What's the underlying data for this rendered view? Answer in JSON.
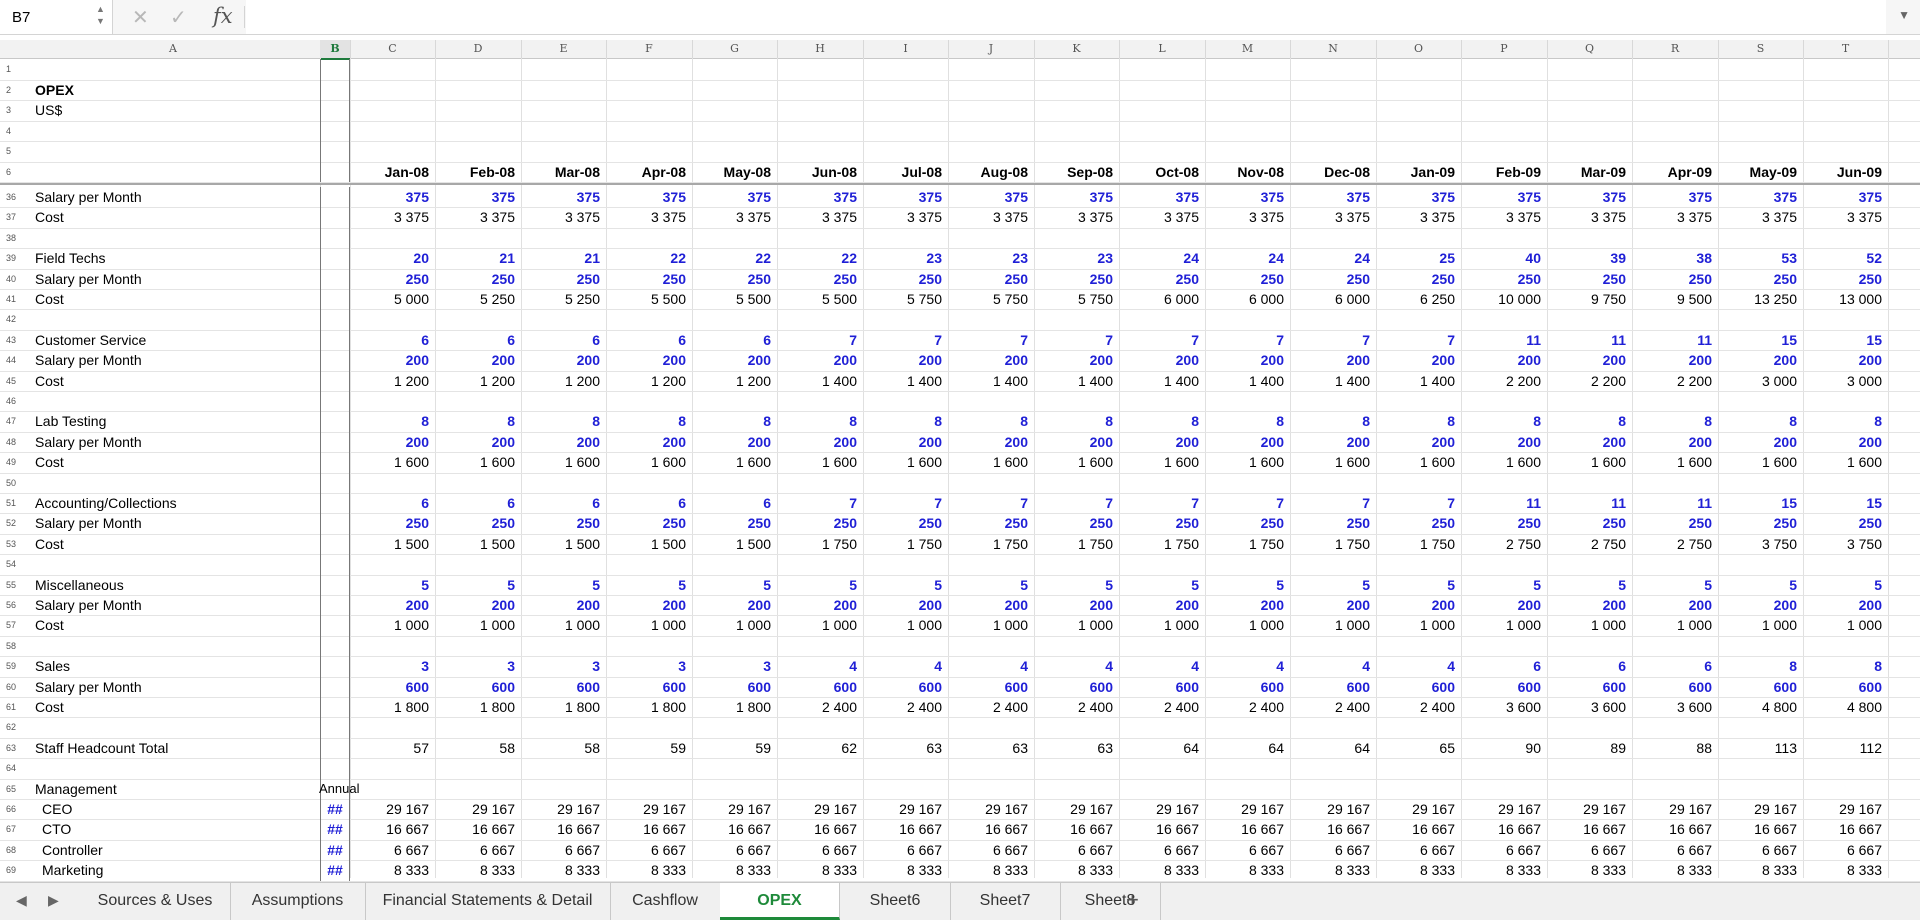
{
  "formula_bar": {
    "cell_ref": "B7",
    "fx": "fx",
    "formula": ""
  },
  "columns": [
    "A",
    "B",
    "C",
    "D",
    "E",
    "F",
    "G",
    "H",
    "I",
    "J",
    "K",
    "L",
    "M",
    "N",
    "O",
    "P",
    "Q",
    "R",
    "S",
    "T"
  ],
  "selected_column": "B",
  "header_rows": [
    {
      "num": "1",
      "a": "",
      "b": "",
      "bold": false,
      "values": []
    },
    {
      "num": "2",
      "a": "OPEX",
      "b": "",
      "bold": true,
      "values": []
    },
    {
      "num": "3",
      "a": "US$",
      "b": "",
      "bold": false,
      "values": []
    },
    {
      "num": "4",
      "a": "",
      "b": "",
      "bold": false,
      "values": []
    },
    {
      "num": "5",
      "a": "",
      "b": "",
      "bold": false,
      "values": []
    },
    {
      "num": "6",
      "a": "",
      "b": "",
      "bold": true,
      "values": [
        "Jan-08",
        "Feb-08",
        "Mar-08",
        "Apr-08",
        "May-08",
        "Jun-08",
        "Jul-08",
        "Aug-08",
        "Sep-08",
        "Oct-08",
        "Nov-08",
        "Dec-08",
        "Jan-09",
        "Feb-09",
        "Mar-09",
        "Apr-09",
        "May-09",
        "Jun-09"
      ]
    }
  ],
  "body_rows": [
    {
      "num": "36",
      "a": "Salary per Month",
      "b": "",
      "style": "blue",
      "values": [
        "375",
        "375",
        "375",
        "375",
        "375",
        "375",
        "375",
        "375",
        "375",
        "375",
        "375",
        "375",
        "375",
        "375",
        "375",
        "375",
        "375",
        "375"
      ]
    },
    {
      "num": "37",
      "a": "Cost",
      "b": "",
      "style": "plain",
      "values": [
        "3 375",
        "3 375",
        "3 375",
        "3 375",
        "3 375",
        "3 375",
        "3 375",
        "3 375",
        "3 375",
        "3 375",
        "3 375",
        "3 375",
        "3 375",
        "3 375",
        "3 375",
        "3 375",
        "3 375",
        "3 375"
      ]
    },
    {
      "num": "38",
      "a": "",
      "b": "",
      "style": "plain",
      "values": []
    },
    {
      "num": "39",
      "a": "Field Techs",
      "b": "",
      "style": "blue",
      "values": [
        "20",
        "21",
        "21",
        "22",
        "22",
        "22",
        "23",
        "23",
        "23",
        "24",
        "24",
        "24",
        "25",
        "40",
        "39",
        "38",
        "53",
        "52"
      ]
    },
    {
      "num": "40",
      "a": "Salary per Month",
      "b": "",
      "style": "blue",
      "values": [
        "250",
        "250",
        "250",
        "250",
        "250",
        "250",
        "250",
        "250",
        "250",
        "250",
        "250",
        "250",
        "250",
        "250",
        "250",
        "250",
        "250",
        "250"
      ]
    },
    {
      "num": "41",
      "a": "Cost",
      "b": "",
      "style": "plain",
      "values": [
        "5 000",
        "5 250",
        "5 250",
        "5 500",
        "5 500",
        "5 500",
        "5 750",
        "5 750",
        "5 750",
        "6 000",
        "6 000",
        "6 000",
        "6 250",
        "10 000",
        "9 750",
        "9 500",
        "13 250",
        "13 000"
      ]
    },
    {
      "num": "42",
      "a": "",
      "b": "",
      "style": "plain",
      "values": []
    },
    {
      "num": "43",
      "a": "Customer Service",
      "b": "",
      "style": "blue",
      "values": [
        "6",
        "6",
        "6",
        "6",
        "6",
        "7",
        "7",
        "7",
        "7",
        "7",
        "7",
        "7",
        "7",
        "11",
        "11",
        "11",
        "15",
        "15"
      ]
    },
    {
      "num": "44",
      "a": "Salary per Month",
      "b": "",
      "style": "blue",
      "values": [
        "200",
        "200",
        "200",
        "200",
        "200",
        "200",
        "200",
        "200",
        "200",
        "200",
        "200",
        "200",
        "200",
        "200",
        "200",
        "200",
        "200",
        "200"
      ]
    },
    {
      "num": "45",
      "a": "Cost",
      "b": "",
      "style": "plain",
      "values": [
        "1 200",
        "1 200",
        "1 200",
        "1 200",
        "1 200",
        "1 400",
        "1 400",
        "1 400",
        "1 400",
        "1 400",
        "1 400",
        "1 400",
        "1 400",
        "2 200",
        "2 200",
        "2 200",
        "3 000",
        "3 000"
      ]
    },
    {
      "num": "46",
      "a": "",
      "b": "",
      "style": "plain",
      "values": []
    },
    {
      "num": "47",
      "a": "Lab Testing",
      "b": "",
      "style": "blue",
      "values": [
        "8",
        "8",
        "8",
        "8",
        "8",
        "8",
        "8",
        "8",
        "8",
        "8",
        "8",
        "8",
        "8",
        "8",
        "8",
        "8",
        "8",
        "8"
      ]
    },
    {
      "num": "48",
      "a": "Salary per Month",
      "b": "",
      "style": "blue",
      "values": [
        "200",
        "200",
        "200",
        "200",
        "200",
        "200",
        "200",
        "200",
        "200",
        "200",
        "200",
        "200",
        "200",
        "200",
        "200",
        "200",
        "200",
        "200"
      ]
    },
    {
      "num": "49",
      "a": "Cost",
      "b": "",
      "style": "plain",
      "values": [
        "1 600",
        "1 600",
        "1 600",
        "1 600",
        "1 600",
        "1 600",
        "1 600",
        "1 600",
        "1 600",
        "1 600",
        "1 600",
        "1 600",
        "1 600",
        "1 600",
        "1 600",
        "1 600",
        "1 600",
        "1 600"
      ]
    },
    {
      "num": "50",
      "a": "",
      "b": "",
      "style": "plain",
      "values": []
    },
    {
      "num": "51",
      "a": "Accounting/Collections",
      "b": "",
      "style": "blue",
      "values": [
        "6",
        "6",
        "6",
        "6",
        "6",
        "7",
        "7",
        "7",
        "7",
        "7",
        "7",
        "7",
        "7",
        "11",
        "11",
        "11",
        "15",
        "15"
      ]
    },
    {
      "num": "52",
      "a": "Salary per Month",
      "b": "",
      "style": "blue",
      "values": [
        "250",
        "250",
        "250",
        "250",
        "250",
        "250",
        "250",
        "250",
        "250",
        "250",
        "250",
        "250",
        "250",
        "250",
        "250",
        "250",
        "250",
        "250"
      ]
    },
    {
      "num": "53",
      "a": "Cost",
      "b": "",
      "style": "plain",
      "values": [
        "1 500",
        "1 500",
        "1 500",
        "1 500",
        "1 500",
        "1 750",
        "1 750",
        "1 750",
        "1 750",
        "1 750",
        "1 750",
        "1 750",
        "1 750",
        "2 750",
        "2 750",
        "2 750",
        "3 750",
        "3 750"
      ]
    },
    {
      "num": "54",
      "a": "",
      "b": "",
      "style": "plain",
      "values": []
    },
    {
      "num": "55",
      "a": "Miscellaneous",
      "b": "",
      "style": "blue",
      "values": [
        "5",
        "5",
        "5",
        "5",
        "5",
        "5",
        "5",
        "5",
        "5",
        "5",
        "5",
        "5",
        "5",
        "5",
        "5",
        "5",
        "5",
        "5"
      ]
    },
    {
      "num": "56",
      "a": "Salary per Month",
      "b": "",
      "style": "blue",
      "values": [
        "200",
        "200",
        "200",
        "200",
        "200",
        "200",
        "200",
        "200",
        "200",
        "200",
        "200",
        "200",
        "200",
        "200",
        "200",
        "200",
        "200",
        "200"
      ]
    },
    {
      "num": "57",
      "a": "Cost",
      "b": "",
      "style": "plain",
      "values": [
        "1 000",
        "1 000",
        "1 000",
        "1 000",
        "1 000",
        "1 000",
        "1 000",
        "1 000",
        "1 000",
        "1 000",
        "1 000",
        "1 000",
        "1 000",
        "1 000",
        "1 000",
        "1 000",
        "1 000",
        "1 000"
      ]
    },
    {
      "num": "58",
      "a": "",
      "b": "",
      "style": "plain",
      "values": []
    },
    {
      "num": "59",
      "a": "Sales",
      "b": "",
      "style": "blue",
      "values": [
        "3",
        "3",
        "3",
        "3",
        "3",
        "4",
        "4",
        "4",
        "4",
        "4",
        "4",
        "4",
        "4",
        "6",
        "6",
        "6",
        "8",
        "8"
      ]
    },
    {
      "num": "60",
      "a": "Salary per Month",
      "b": "",
      "style": "blue",
      "values": [
        "600",
        "600",
        "600",
        "600",
        "600",
        "600",
        "600",
        "600",
        "600",
        "600",
        "600",
        "600",
        "600",
        "600",
        "600",
        "600",
        "600",
        "600"
      ]
    },
    {
      "num": "61",
      "a": "Cost",
      "b": "",
      "style": "plain",
      "values": [
        "1 800",
        "1 800",
        "1 800",
        "1 800",
        "1 800",
        "2 400",
        "2 400",
        "2 400",
        "2 400",
        "2 400",
        "2 400",
        "2 400",
        "2 400",
        "3 600",
        "3 600",
        "3 600",
        "4 800",
        "4 800"
      ]
    },
    {
      "num": "62",
      "a": "",
      "b": "",
      "style": "plain",
      "values": []
    },
    {
      "num": "63",
      "a": "Staff Headcount Total",
      "b": "",
      "style": "plain",
      "values": [
        "57",
        "58",
        "58",
        "59",
        "59",
        "62",
        "63",
        "63",
        "63",
        "64",
        "64",
        "64",
        "65",
        "90",
        "89",
        "88",
        "113",
        "112"
      ]
    },
    {
      "num": "64",
      "a": "",
      "b": "",
      "style": "plain",
      "values": []
    },
    {
      "num": "65",
      "a": "Management",
      "b": "Annual",
      "style": "plain",
      "values": []
    },
    {
      "num": "66",
      "a": "CEO",
      "b": "##",
      "style": "plain",
      "values": [
        "29 167",
        "29 167",
        "29 167",
        "29 167",
        "29 167",
        "29 167",
        "29 167",
        "29 167",
        "29 167",
        "29 167",
        "29 167",
        "29 167",
        "29 167",
        "29 167",
        "29 167",
        "29 167",
        "29 167",
        "29 167"
      ]
    },
    {
      "num": "67",
      "a": "CTO",
      "b": "##",
      "style": "plain",
      "values": [
        "16 667",
        "16 667",
        "16 667",
        "16 667",
        "16 667",
        "16 667",
        "16 667",
        "16 667",
        "16 667",
        "16 667",
        "16 667",
        "16 667",
        "16 667",
        "16 667",
        "16 667",
        "16 667",
        "16 667",
        "16 667"
      ]
    },
    {
      "num": "68",
      "a": "Controller",
      "b": "##",
      "style": "plain",
      "values": [
        "6 667",
        "6 667",
        "6 667",
        "6 667",
        "6 667",
        "6 667",
        "6 667",
        "6 667",
        "6 667",
        "6 667",
        "6 667",
        "6 667",
        "6 667",
        "6 667",
        "6 667",
        "6 667",
        "6 667",
        "6 667"
      ]
    },
    {
      "num": "69",
      "a": "Marketing",
      "b": "##",
      "style": "plain",
      "values": [
        "8 333",
        "8 333",
        "8 333",
        "8 333",
        "8 333",
        "8 333",
        "8 333",
        "8 333",
        "8 333",
        "8 333",
        "8 333",
        "8 333",
        "8 333",
        "8 333",
        "8 333",
        "8 333",
        "8 333",
        "8 333"
      ]
    }
  ],
  "tabs": [
    "Sources & Uses",
    "Assumptions",
    "Financial Statements & Detail",
    "Cashflow",
    "OPEX",
    "Sheet6",
    "Sheet7",
    "Sheet8"
  ],
  "active_tab": "OPEX",
  "add_tab": "+"
}
